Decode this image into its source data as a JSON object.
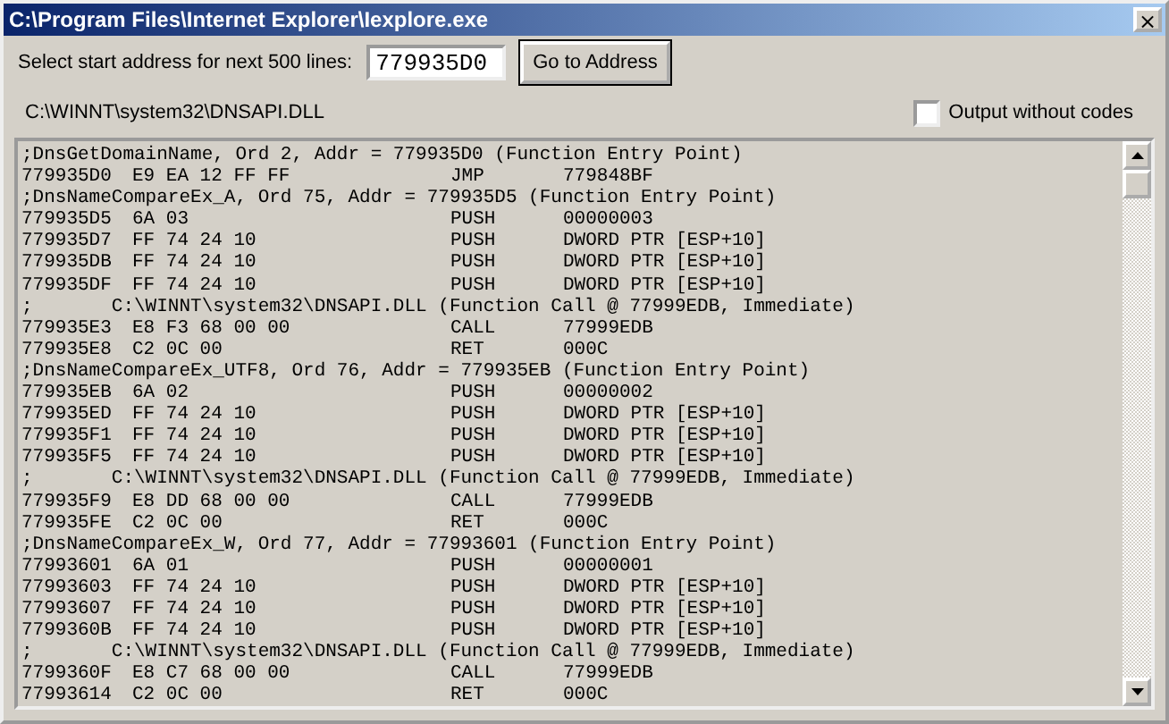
{
  "window": {
    "title": "C:\\Program Files\\Internet Explorer\\Iexplore.exe",
    "close": "×"
  },
  "address_prompt": "Select start address for next 500 lines:",
  "address_field": {
    "value": "779935D0"
  },
  "go_button": "Go to Address",
  "module_path": "C:\\WINNT\\system32\\DNSAPI.DLL",
  "output_without_codes": {
    "label": "Output without codes",
    "checked": false
  },
  "listing": [
    {
      "kind": "comment",
      "text": ";DnsGetDomainName, Ord 2, Addr = 779935D0 (Function Entry Point)"
    },
    {
      "kind": "code",
      "address": "779935D0",
      "bytes": "E9 EA 12 FF FF",
      "mnemonic": "JMP",
      "operand": "779848BF"
    },
    {
      "kind": "comment",
      "text": ";DnsNameCompareEx_A, Ord 75, Addr = 779935D5 (Function Entry Point)"
    },
    {
      "kind": "code",
      "address": "779935D5",
      "bytes": "6A 03",
      "mnemonic": "PUSH",
      "operand": "00000003"
    },
    {
      "kind": "code",
      "address": "779935D7",
      "bytes": "FF 74 24 10",
      "mnemonic": "PUSH",
      "operand": "DWORD PTR [ESP+10]"
    },
    {
      "kind": "code",
      "address": "779935DB",
      "bytes": "FF 74 24 10",
      "mnemonic": "PUSH",
      "operand": "DWORD PTR [ESP+10]"
    },
    {
      "kind": "code",
      "address": "779935DF",
      "bytes": "FF 74 24 10",
      "mnemonic": "PUSH",
      "operand": "DWORD PTR [ESP+10]"
    },
    {
      "kind": "comment",
      "text": ";       C:\\WINNT\\system32\\DNSAPI.DLL (Function Call @ 77999EDB, Immediate)"
    },
    {
      "kind": "code",
      "address": "779935E3",
      "bytes": "E8 F3 68 00 00",
      "mnemonic": "CALL",
      "operand": "77999EDB"
    },
    {
      "kind": "code",
      "address": "779935E8",
      "bytes": "C2 0C 00",
      "mnemonic": "RET",
      "operand": "000C"
    },
    {
      "kind": "comment",
      "text": ";DnsNameCompareEx_UTF8, Ord 76, Addr = 779935EB (Function Entry Point)"
    },
    {
      "kind": "code",
      "address": "779935EB",
      "bytes": "6A 02",
      "mnemonic": "PUSH",
      "operand": "00000002"
    },
    {
      "kind": "code",
      "address": "779935ED",
      "bytes": "FF 74 24 10",
      "mnemonic": "PUSH",
      "operand": "DWORD PTR [ESP+10]"
    },
    {
      "kind": "code",
      "address": "779935F1",
      "bytes": "FF 74 24 10",
      "mnemonic": "PUSH",
      "operand": "DWORD PTR [ESP+10]"
    },
    {
      "kind": "code",
      "address": "779935F5",
      "bytes": "FF 74 24 10",
      "mnemonic": "PUSH",
      "operand": "DWORD PTR [ESP+10]"
    },
    {
      "kind": "comment",
      "text": ";       C:\\WINNT\\system32\\DNSAPI.DLL (Function Call @ 77999EDB, Immediate)"
    },
    {
      "kind": "code",
      "address": "779935F9",
      "bytes": "E8 DD 68 00 00",
      "mnemonic": "CALL",
      "operand": "77999EDB"
    },
    {
      "kind": "code",
      "address": "779935FE",
      "bytes": "C2 0C 00",
      "mnemonic": "RET",
      "operand": "000C"
    },
    {
      "kind": "comment",
      "text": ";DnsNameCompareEx_W, Ord 77, Addr = 77993601 (Function Entry Point)"
    },
    {
      "kind": "code",
      "address": "77993601",
      "bytes": "6A 01",
      "mnemonic": "PUSH",
      "operand": "00000001"
    },
    {
      "kind": "code",
      "address": "77993603",
      "bytes": "FF 74 24 10",
      "mnemonic": "PUSH",
      "operand": "DWORD PTR [ESP+10]"
    },
    {
      "kind": "code",
      "address": "77993607",
      "bytes": "FF 74 24 10",
      "mnemonic": "PUSH",
      "operand": "DWORD PTR [ESP+10]"
    },
    {
      "kind": "code",
      "address": "7799360B",
      "bytes": "FF 74 24 10",
      "mnemonic": "PUSH",
      "operand": "DWORD PTR [ESP+10]"
    },
    {
      "kind": "comment",
      "text": ";       C:\\WINNT\\system32\\DNSAPI.DLL (Function Call @ 77999EDB, Immediate)"
    },
    {
      "kind": "code",
      "address": "7799360F",
      "bytes": "E8 C7 68 00 00",
      "mnemonic": "CALL",
      "operand": "77999EDB"
    },
    {
      "kind": "code",
      "address": "77993614",
      "bytes": "C2 0C 00",
      "mnemonic": "RET",
      "operand": "000C"
    }
  ]
}
